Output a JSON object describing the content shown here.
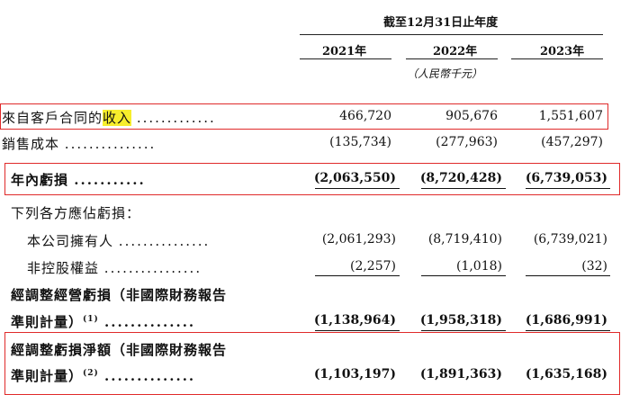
{
  "header": {
    "period": "截至12月31日止年度",
    "years": [
      "2021年",
      "2022年",
      "2023年"
    ],
    "units": "（人民幣千元）"
  },
  "rows": [
    {
      "prefix": "來自客戶合同的",
      "highlight": "收入",
      "dots": ".............",
      "values": [
        "466,720",
        "905,676",
        "1,551,607"
      ],
      "bold": false
    },
    {
      "label": "銷售成本",
      "dots": "...............",
      "values": [
        "(135,734)",
        "(277,963)",
        "(457,297)"
      ],
      "bold": false
    },
    {
      "label": "年內虧損",
      "dots": "...........",
      "values": [
        "(2,063,550)",
        "(8,720,428)",
        "(6,739,053)"
      ],
      "bold": true
    },
    {
      "label": "下列各方應佔虧損：",
      "values": [],
      "bold": false
    },
    {
      "label": "本公司擁有人",
      "dots": "...............",
      "values": [
        "(2,061,293)",
        "(8,719,410)",
        "(6,739,021)"
      ],
      "bold": false
    },
    {
      "label": "非控股權益",
      "dots": "................",
      "values": [
        "(2,257)",
        "(1,018)",
        "(32)"
      ],
      "bold": false
    },
    {
      "label": "經調整經營虧損（非國際財務報告",
      "values": [],
      "bold": true
    },
    {
      "label": "準則計量）",
      "note": "(1)",
      "dots": "..............",
      "values": [
        "(1,138,964)",
        "(1,958,318)",
        "(1,686,991)"
      ],
      "bold": true
    },
    {
      "label": "經調整虧損淨額（非國際財務報告",
      "values": [],
      "bold": true
    },
    {
      "label": "準則計量）",
      "note": "(2)",
      "dots": "..............",
      "values": [
        "(1,103,197)",
        "(1,891,363)",
        "(1,635,168)"
      ],
      "bold": true
    }
  ],
  "accent": {
    "box": "#e02a2a",
    "highlight": "#f7ee2c"
  }
}
